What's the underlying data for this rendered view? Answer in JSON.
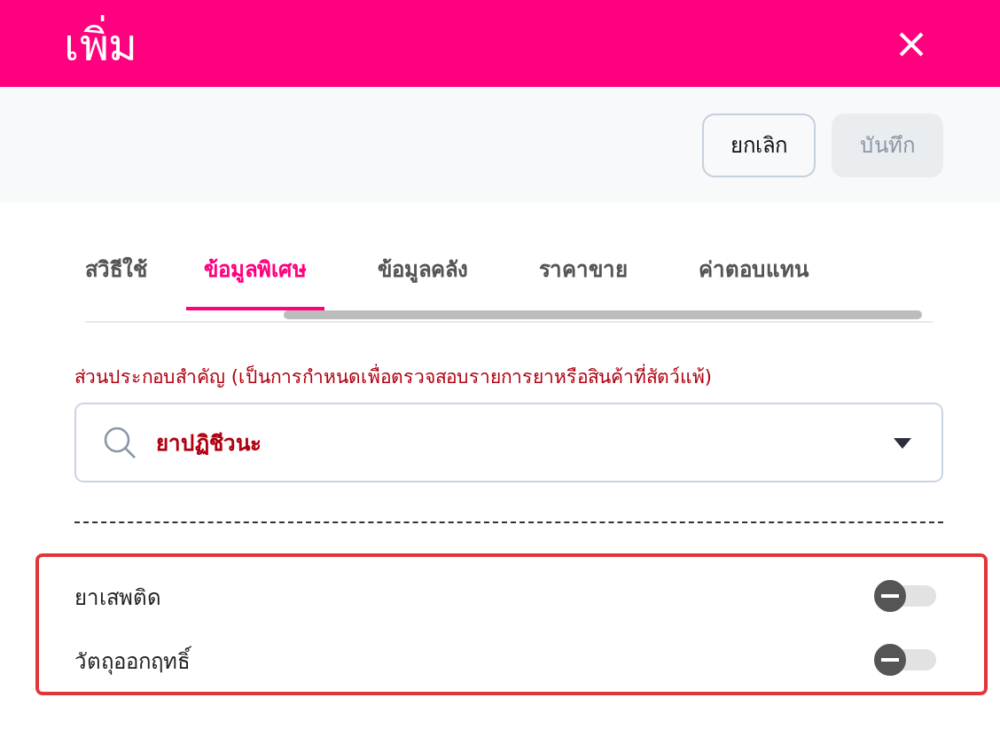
{
  "dialog": {
    "title": "เพิ่ม"
  },
  "actions": [
    {
      "label": "ยกเลิก",
      "disabled": false
    },
    {
      "label": "บันทึก",
      "disabled": true
    }
  ],
  "tabs": [
    {
      "label": "สวิธีใช้",
      "selected": false
    },
    {
      "label": "ข้อมูลพิเศษ",
      "selected": true
    },
    {
      "label": "ข้อมูลคลัง",
      "selected": false
    },
    {
      "label": "ราคาขาย",
      "selected": false
    },
    {
      "label": "ค่าตอบแทน",
      "selected": false
    }
  ],
  "field": {
    "label": "ส่วนประกอบสำคัญ (เป็นการกำหนดเพื่อตรวจสอบรายการยาหรือสินค้าที่สัตว์แพ้)",
    "value": "ยาปฏิชีวนะ"
  },
  "switches": [
    {
      "label": "ยาเสพติด",
      "on": false
    },
    {
      "label": "วัตถุออกฤทธิ์",
      "on": false
    }
  ]
}
